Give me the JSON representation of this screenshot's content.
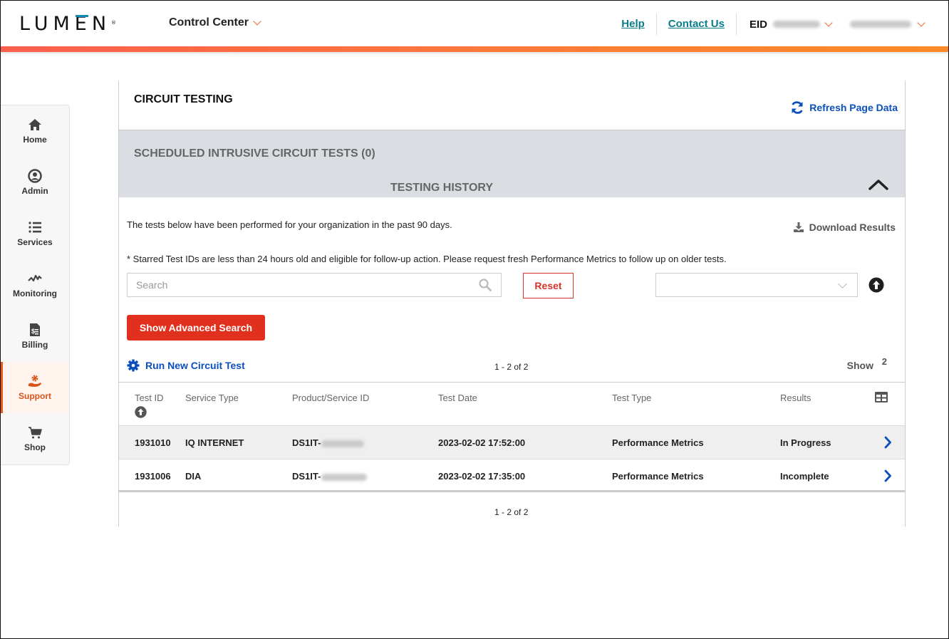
{
  "header": {
    "logo": "LUMEN",
    "logo_mark": "®",
    "app_name": "Control Center",
    "links": [
      {
        "label": "Help"
      },
      {
        "label": "Contact Us"
      }
    ],
    "eid_label": "EID",
    "eid_value_redacted": true,
    "user_name_redacted": true,
    "gradient_colors": [
      "#fb5f4b",
      "#fd8a26"
    ]
  },
  "sidebar": {
    "items": [
      {
        "label": "Home",
        "icon": "home-icon",
        "active": false
      },
      {
        "label": "Admin",
        "icon": "user-circle-icon",
        "active": false
      },
      {
        "label": "Services",
        "icon": "list-icon",
        "active": false
      },
      {
        "label": "Monitoring",
        "icon": "pulse-icon",
        "active": false
      },
      {
        "label": "Billing",
        "icon": "invoice-icon",
        "active": false
      },
      {
        "label": "Support",
        "icon": "support-hand-gear-icon",
        "active": true
      },
      {
        "label": "Shop",
        "icon": "cart-icon",
        "active": false
      }
    ],
    "accent_color": "#e35a1d"
  },
  "main": {
    "title": "CIRCUIT TESTING",
    "refresh_label": "Refresh Page Data",
    "scheduled_title": "SCHEDULED INTRUSIVE CIRCUIT TESTS (0)",
    "history_title": "TESTING HISTORY",
    "description": "The tests below have been performed for your organization in the past 90 days.",
    "note": "* Starred Test IDs are less than 24 hours old and eligible for follow-up action. Please request fresh Performance Metrics to follow up on older tests.",
    "download_label": "Download Results",
    "search": {
      "placeholder": "Search",
      "value": ""
    },
    "reset_label": "Reset",
    "sort_select": {
      "selected": ""
    },
    "advanced_search_label": "Show Advanced Search",
    "run_test_label": "Run New Circuit Test",
    "range_text": "1 - 2 of 2",
    "show_label": "Show",
    "show_value": "2",
    "table": {
      "columns": [
        "Test ID",
        "Service Type",
        "Product/Service ID",
        "Test Date",
        "Test Type",
        "Results"
      ],
      "sorted_column": "Test ID",
      "sort_direction": "ascending",
      "rows": [
        {
          "test_id": "1931010",
          "service_type": "IQ INTERNET",
          "product_id_prefix": "DS1IT-",
          "product_id_redacted": true,
          "test_date": "2023-02-02 17:52:00",
          "test_type": "Performance Metrics",
          "result": "In Progress"
        },
        {
          "test_id": "1931006",
          "service_type": "DIA",
          "product_id_prefix": "DS1IT-",
          "product_id_redacted": true,
          "test_date": "2023-02-02 17:35:00",
          "test_type": "Performance Metrics",
          "result": "Incomplete"
        }
      ]
    },
    "colors": {
      "link_blue": "#0b4fbf",
      "primary_red": "#e1301e",
      "band_gray": "#dadde1"
    }
  }
}
